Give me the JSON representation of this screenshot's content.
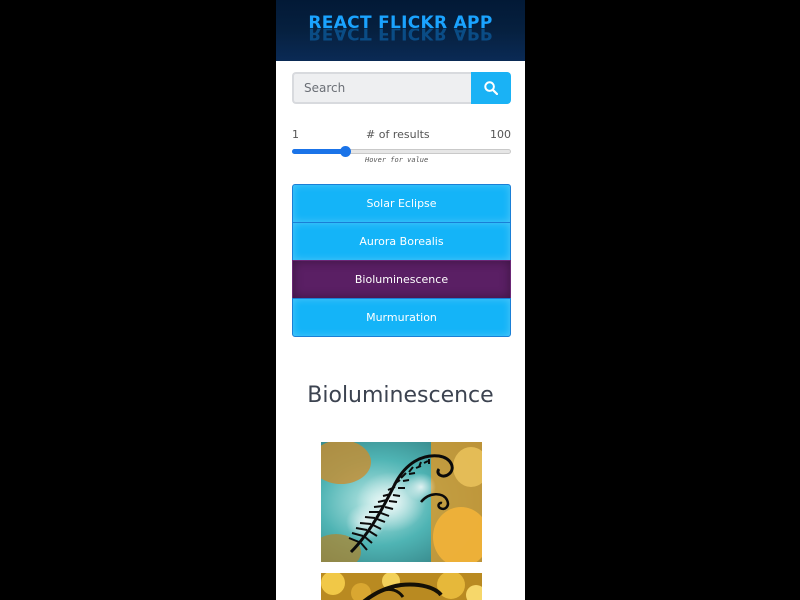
{
  "header": {
    "title": "REACT FLICKR APP"
  },
  "search": {
    "placeholder": "Search",
    "value": "",
    "button_icon": "search-icon"
  },
  "results_slider": {
    "min_label": "1",
    "max_label": "100",
    "title": "# of results",
    "hint": "Hover for value",
    "min": 1,
    "max": 100,
    "value": 25
  },
  "topics": [
    {
      "label": "Solar Eclipse",
      "active": false
    },
    {
      "label": "Aurora Borealis",
      "active": false
    },
    {
      "label": "Bioluminescence",
      "active": true
    },
    {
      "label": "Murmuration",
      "active": false
    }
  ],
  "results": {
    "heading": "Bioluminescence",
    "photos": [
      {
        "subject": "fern-silhouette-photo"
      },
      {
        "subject": "fern-silhouette-bokeh-photo"
      }
    ]
  },
  "colors": {
    "page_background": "#000000",
    "header_background": "#06203f",
    "title": "#1aa3ff",
    "accent": "#14b4f8",
    "active_topic": "#5a1f64",
    "slider": "#1a73e8"
  }
}
